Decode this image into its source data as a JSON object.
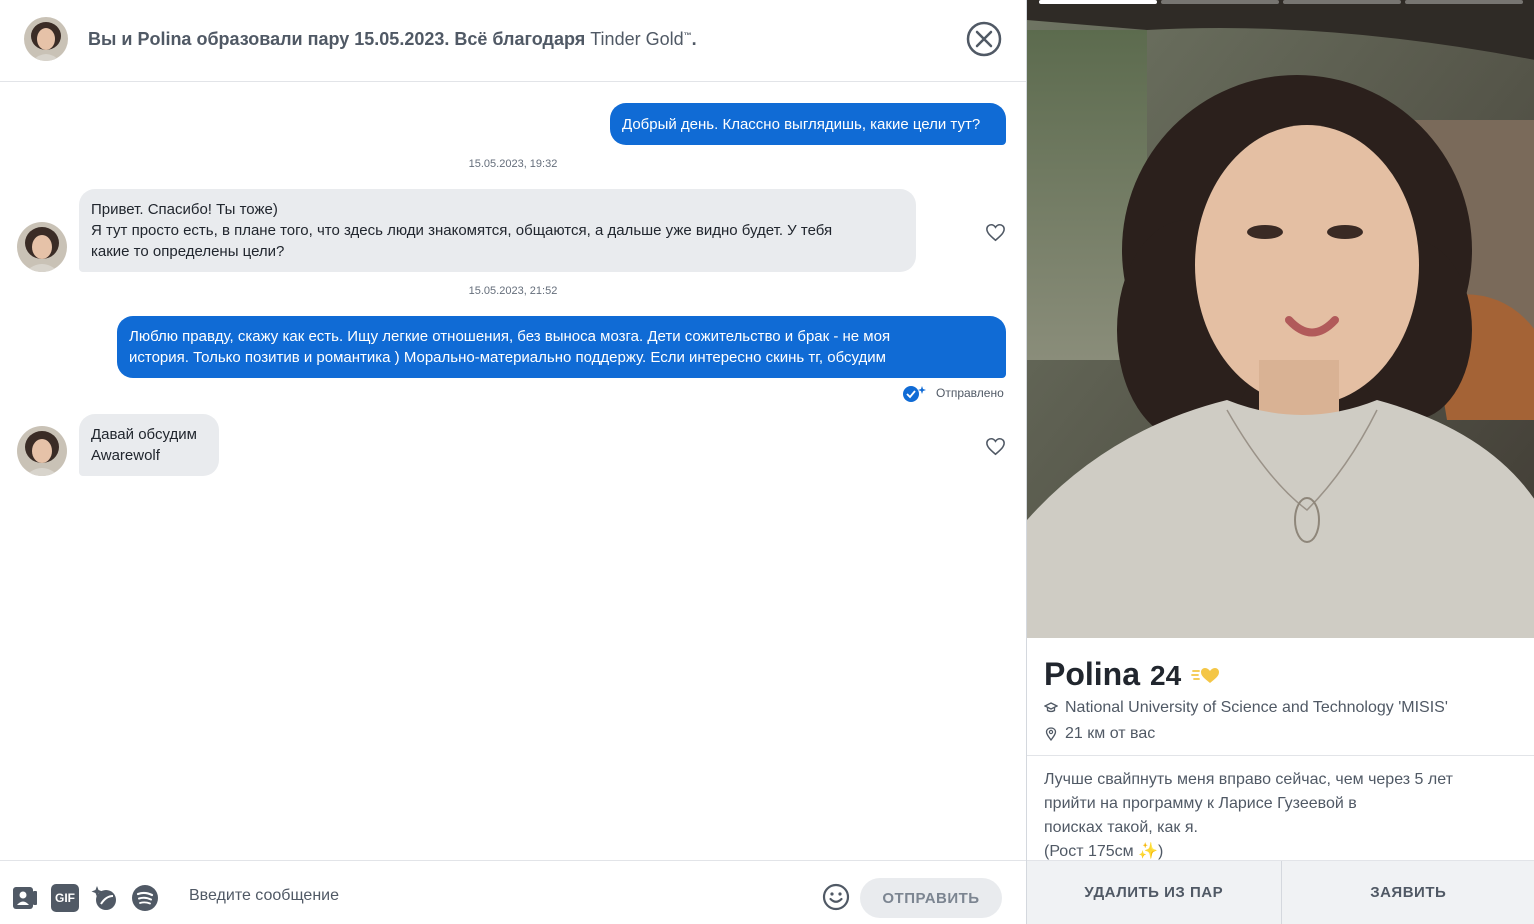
{
  "header": {
    "match_text": "Вы и Polina образовали пару 15.05.2023. Всё благодаря",
    "brand": "Tinder Gold",
    "trademark": "™",
    "period": "."
  },
  "messages": [
    {
      "direction": "out",
      "lines": [
        "Добрый день. Классно выглядишь, какие цели тут?"
      ]
    },
    {
      "type": "timestamp",
      "text": "15.05.2023, 19:32"
    },
    {
      "direction": "in",
      "lines": [
        "Привет. Спасибо! Ты тоже)",
        "Я тут просто есть, в плане того, что здесь люди знакомятся, общаются, а дальше уже видно будет. У тебя",
        "какие то определены цели?"
      ]
    },
    {
      "type": "timestamp",
      "text": "15.05.2023, 21:52"
    },
    {
      "direction": "out",
      "lines": [
        "Люблю правду, скажу как есть. Ищу легкие отношения, без выноса мозга. Дети сожительство и брак - не моя",
        "история. Только позитив и романтика ) Морально-материально поддержу. Если интересно скинь тг, обсудим"
      ]
    },
    {
      "type": "status",
      "text": "Отправлено"
    },
    {
      "direction": "in",
      "lines": [
        "Давай обсудим",
        "Awarewolf"
      ]
    }
  ],
  "composer": {
    "placeholder": "Введите сообщение",
    "gif_label": "GIF",
    "send_label": "ОТПРАВИТЬ",
    "tools": [
      "sticker-icon",
      "gif-icon",
      "sparkle-icon",
      "spotify-icon"
    ]
  },
  "profile": {
    "name": "Polina",
    "age": "24",
    "school": "National University of Science and Technology 'MISIS'",
    "distance": "21 км от вас",
    "bio_lines": [
      "Лучше свайпнуть меня вправо сейчас, чем через 5 лет",
      "прийти на программу к Ларисе Гузеевой в",
      "поисках такой, как я.",
      "(Рост 175см ✨)"
    ],
    "photo_count": 4,
    "active_photo": 1
  },
  "actions": {
    "unmatch_label": "УДАЛИТЬ ИЗ ПАР",
    "report_label": "ЗАЯВИТЬ"
  },
  "colors": {
    "outgoing_bubble": "#106bd5",
    "incoming_bubble": "#e9ebee",
    "gold": "#f4c646"
  }
}
